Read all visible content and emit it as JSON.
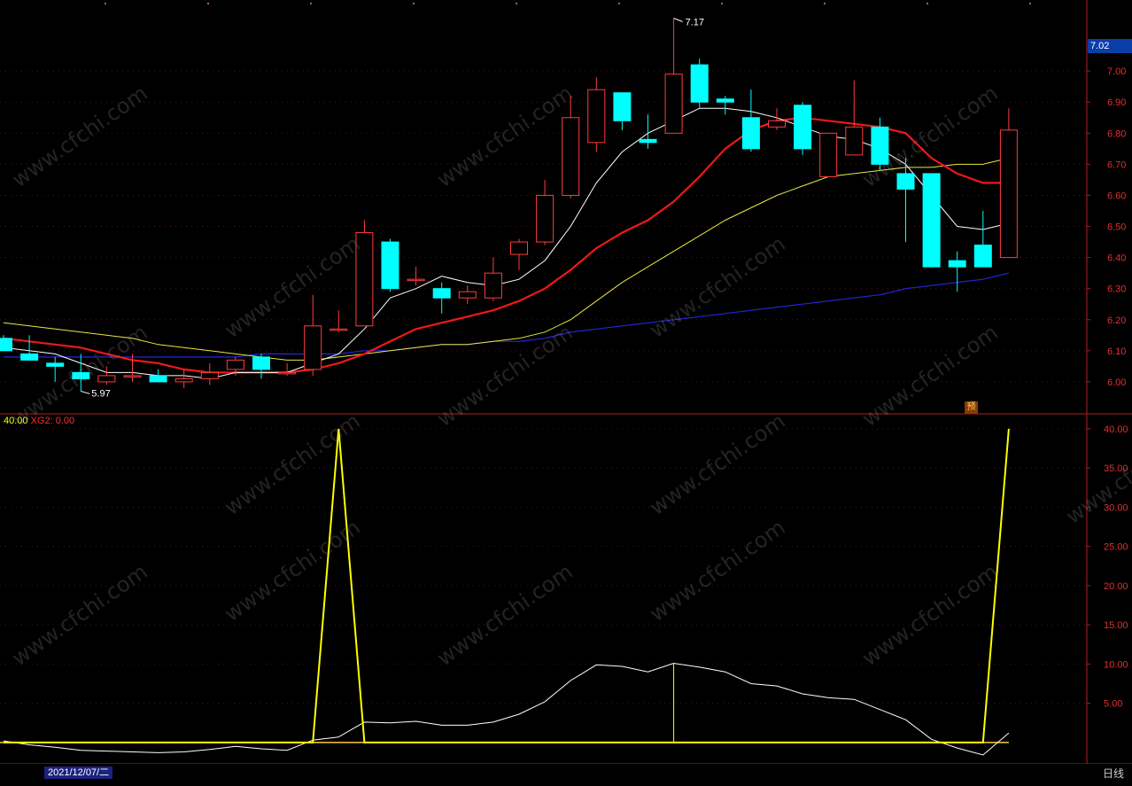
{
  "chart_data": [
    {
      "type": "candlestick",
      "panel": "price",
      "ylim": [
        5.9,
        7.2
      ],
      "ticks": [
        "7.00",
        "6.90",
        "6.80",
        "6.70",
        "6.60",
        "6.50",
        "6.40",
        "6.30",
        "6.20",
        "6.10",
        "6.00"
      ],
      "current_price": "7.02",
      "high_label": "7.17",
      "low_label": "5.97",
      "candles": [
        {
          "o": 6.14,
          "h": 6.15,
          "l": 6.1,
          "c": 6.1
        },
        {
          "o": 6.09,
          "h": 6.15,
          "l": 6.07,
          "c": 6.07
        },
        {
          "o": 6.06,
          "h": 6.08,
          "l": 6.0,
          "c": 6.05
        },
        {
          "o": 6.03,
          "h": 6.09,
          "l": 5.97,
          "c": 6.01
        },
        {
          "o": 6.0,
          "h": 6.05,
          "l": 5.99,
          "c": 6.02
        },
        {
          "o": 6.02,
          "h": 6.09,
          "l": 6.0,
          "c": 6.02
        },
        {
          "o": 6.02,
          "h": 6.04,
          "l": 6.0,
          "c": 6.0
        },
        {
          "o": 6.0,
          "h": 6.04,
          "l": 5.98,
          "c": 6.01
        },
        {
          "o": 6.01,
          "h": 6.06,
          "l": 5.99,
          "c": 6.03
        },
        {
          "o": 6.04,
          "h": 6.08,
          "l": 6.02,
          "c": 6.07
        },
        {
          "o": 6.08,
          "h": 6.09,
          "l": 6.01,
          "c": 6.04
        },
        {
          "o": 6.03,
          "h": 6.06,
          "l": 6.02,
          "c": 6.03
        },
        {
          "o": 6.04,
          "h": 6.28,
          "l": 6.02,
          "c": 6.18
        },
        {
          "o": 6.17,
          "h": 6.23,
          "l": 6.16,
          "c": 6.17
        },
        {
          "o": 6.18,
          "h": 6.52,
          "l": 6.18,
          "c": 6.48
        },
        {
          "o": 6.45,
          "h": 6.46,
          "l": 6.29,
          "c": 6.3
        },
        {
          "o": 6.33,
          "h": 6.37,
          "l": 6.31,
          "c": 6.33
        },
        {
          "o": 6.3,
          "h": 6.32,
          "l": 6.22,
          "c": 6.27
        },
        {
          "o": 6.27,
          "h": 6.31,
          "l": 6.25,
          "c": 6.29
        },
        {
          "o": 6.27,
          "h": 6.4,
          "l": 6.26,
          "c": 6.35
        },
        {
          "o": 6.41,
          "h": 6.46,
          "l": 6.36,
          "c": 6.45
        },
        {
          "o": 6.45,
          "h": 6.65,
          "l": 6.44,
          "c": 6.6
        },
        {
          "o": 6.6,
          "h": 6.92,
          "l": 6.59,
          "c": 6.85
        },
        {
          "o": 6.77,
          "h": 6.98,
          "l": 6.74,
          "c": 6.94
        },
        {
          "o": 6.93,
          "h": 6.93,
          "l": 6.81,
          "c": 6.84
        },
        {
          "o": 6.78,
          "h": 6.86,
          "l": 6.75,
          "c": 6.77
        },
        {
          "o": 6.8,
          "h": 7.17,
          "l": 6.8,
          "c": 6.99
        },
        {
          "o": 7.02,
          "h": 7.04,
          "l": 6.88,
          "c": 6.9
        },
        {
          "o": 6.91,
          "h": 6.92,
          "l": 6.86,
          "c": 6.9
        },
        {
          "o": 6.85,
          "h": 6.94,
          "l": 6.74,
          "c": 6.75
        },
        {
          "o": 6.82,
          "h": 6.88,
          "l": 6.81,
          "c": 6.84
        },
        {
          "o": 6.89,
          "h": 6.9,
          "l": 6.73,
          "c": 6.75
        },
        {
          "o": 6.66,
          "h": 6.8,
          "l": 6.66,
          "c": 6.8
        },
        {
          "o": 6.73,
          "h": 6.97,
          "l": 6.73,
          "c": 6.82
        },
        {
          "o": 6.82,
          "h": 6.85,
          "l": 6.68,
          "c": 6.7
        },
        {
          "o": 6.67,
          "h": 6.72,
          "l": 6.45,
          "c": 6.62
        },
        {
          "o": 6.67,
          "h": 6.67,
          "l": 6.37,
          "c": 6.37
        },
        {
          "o": 6.39,
          "h": 6.42,
          "l": 6.29,
          "c": 6.37
        },
        {
          "o": 6.44,
          "h": 6.55,
          "l": 6.37,
          "c": 6.37
        },
        {
          "o": 6.4,
          "h": 6.88,
          "l": 6.4,
          "c": 6.81
        }
      ],
      "ma5": [
        6.11,
        6.1,
        6.09,
        6.06,
        6.03,
        6.03,
        6.02,
        6.02,
        6.01,
        6.03,
        6.03,
        6.03,
        6.06,
        6.09,
        6.17,
        6.27,
        6.3,
        6.34,
        6.32,
        6.31,
        6.33,
        6.39,
        6.5,
        6.64,
        6.74,
        6.8,
        6.84,
        6.88,
        6.88,
        6.87,
        6.85,
        6.82,
        6.79,
        6.78,
        6.75,
        6.7,
        6.6,
        6.5,
        6.49,
        6.51
      ],
      "ma10": [
        6.14,
        6.13,
        6.12,
        6.11,
        6.09,
        6.07,
        6.06,
        6.04,
        6.03,
        6.03,
        6.03,
        6.03,
        6.04,
        6.06,
        6.09,
        6.13,
        6.17,
        6.19,
        6.21,
        6.23,
        6.26,
        6.3,
        6.36,
        6.43,
        6.48,
        6.52,
        6.58,
        6.66,
        6.75,
        6.81,
        6.84,
        6.85,
        6.84,
        6.83,
        6.82,
        6.8,
        6.72,
        6.67,
        6.64,
        6.64
      ],
      "ma20": [
        6.19,
        6.18,
        6.17,
        6.16,
        6.15,
        6.14,
        6.12,
        6.11,
        6.1,
        6.09,
        6.08,
        6.07,
        6.07,
        6.08,
        6.09,
        6.1,
        6.11,
        6.12,
        6.12,
        6.13,
        6.14,
        6.16,
        6.2,
        6.26,
        6.32,
        6.37,
        6.42,
        6.47,
        6.52,
        6.56,
        6.6,
        6.63,
        6.66,
        6.67,
        6.68,
        6.69,
        6.69,
        6.7,
        6.7,
        6.72
      ],
      "ma60": [
        6.08,
        6.08,
        6.08,
        6.08,
        6.08,
        6.08,
        6.08,
        6.08,
        6.08,
        6.08,
        6.09,
        6.09,
        6.09,
        6.09,
        6.1,
        6.1,
        6.11,
        6.12,
        6.12,
        6.13,
        6.13,
        6.14,
        6.16,
        6.17,
        6.18,
        6.19,
        6.2,
        6.21,
        6.22,
        6.23,
        6.24,
        6.25,
        6.26,
        6.27,
        6.28,
        6.3,
        6.31,
        6.32,
        6.33,
        6.35
      ]
    },
    {
      "type": "line",
      "panel": "indicator",
      "ylim": [
        -2.5,
        41
      ],
      "ticks": [
        "40.00",
        "35.00",
        "30.00",
        "25.00",
        "20.00",
        "15.00",
        "10.00",
        "5.00"
      ],
      "label_value": "40.00",
      "xg2_label": "XG2: 0.00",
      "xg1": [
        0,
        0,
        0,
        0,
        0,
        0,
        0,
        0,
        0,
        0,
        0,
        0,
        0,
        40,
        0,
        0,
        0,
        0,
        0,
        0,
        0,
        0,
        0,
        0,
        0,
        0,
        0,
        0,
        0,
        0,
        0,
        0,
        0,
        0,
        0,
        0,
        0,
        0,
        0,
        40
      ],
      "white": [
        0.2,
        -0.3,
        -0.6,
        -1.0,
        -1.1,
        -1.2,
        -1.3,
        -1.2,
        -0.9,
        -0.5,
        -0.8,
        -1.0,
        0.3,
        0.7,
        2.6,
        2.5,
        2.7,
        2.2,
        2.2,
        2.6,
        3.6,
        5.2,
        7.9,
        9.9,
        9.7,
        9.0,
        10.1,
        9.6,
        9.0,
        7.5,
        7.2,
        6.2,
        5.7,
        5.5,
        4.2,
        2.9,
        0.4,
        -0.7,
        -1.6,
        1.2
      ],
      "spike_index": 26
    }
  ],
  "bottom": {
    "date": "2021/12/07/二",
    "period": "日线"
  },
  "badge": "预",
  "watermark": "www.cfchi.com"
}
